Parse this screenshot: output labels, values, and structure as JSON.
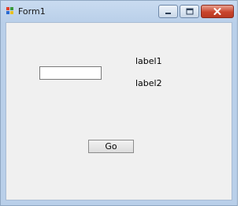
{
  "window": {
    "title": "Form1",
    "icon": "windows-form-icon",
    "caption_buttons": [
      "minimize-icon",
      "maximize-icon",
      "close-icon"
    ]
  },
  "form": {
    "textbox_value": "",
    "label1": "label1",
    "label2": "label2",
    "go_label": "Go"
  },
  "colors": {
    "titlebar": "#c3d6ee",
    "client_background": "#f0f0f0",
    "close_button": "#c9452d"
  }
}
